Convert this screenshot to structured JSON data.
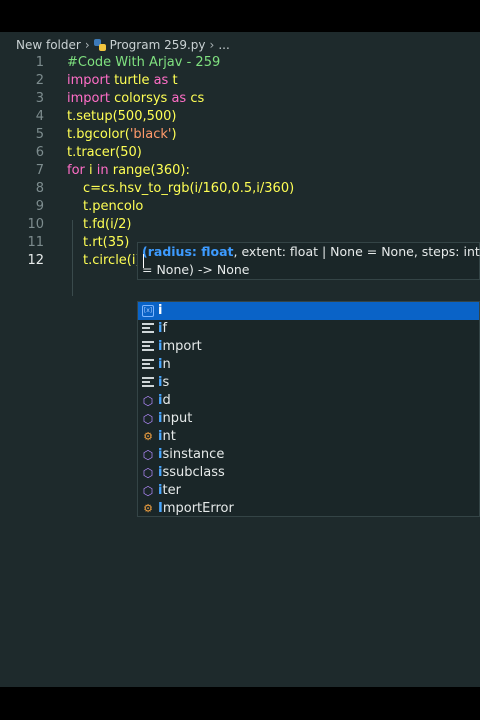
{
  "breadcrumb": {
    "folder": "New folder",
    "file": "Program 259.py",
    "more": "..."
  },
  "code_lines": [
    {
      "n": "1",
      "tokens": [
        {
          "t": "#Code With Arjav - 259",
          "c": "comment"
        }
      ]
    },
    {
      "n": "2",
      "tokens": [
        {
          "t": "import ",
          "c": "kw"
        },
        {
          "t": "turtle ",
          "c": "plain"
        },
        {
          "t": "as ",
          "c": "kw"
        },
        {
          "t": "t",
          "c": "plain"
        }
      ]
    },
    {
      "n": "3",
      "tokens": [
        {
          "t": "import ",
          "c": "kw"
        },
        {
          "t": "colorsys ",
          "c": "plain"
        },
        {
          "t": "as ",
          "c": "kw"
        },
        {
          "t": "cs",
          "c": "plain"
        }
      ]
    },
    {
      "n": "4",
      "tokens": [
        {
          "t": "t.setup(500,500)",
          "c": "plain"
        }
      ]
    },
    {
      "n": "5",
      "tokens": [
        {
          "t": "t.bgcolor(",
          "c": "plain"
        },
        {
          "t": "'black'",
          "c": "str"
        },
        {
          "t": ")",
          "c": "plain"
        }
      ]
    },
    {
      "n": "6",
      "tokens": [
        {
          "t": "t.tracer(50)",
          "c": "plain"
        }
      ]
    },
    {
      "n": "7",
      "tokens": [
        {
          "t": "for ",
          "c": "kw"
        },
        {
          "t": "i ",
          "c": "plain"
        },
        {
          "t": "in ",
          "c": "kw"
        },
        {
          "t": "range(360):",
          "c": "plain"
        }
      ]
    },
    {
      "n": "8",
      "indent": true,
      "tokens": [
        {
          "t": "c=cs.hsv_to_rgb(i/160,0.5,i/360)",
          "c": "plain"
        }
      ]
    },
    {
      "n": "9",
      "indent": true,
      "tokens": [
        {
          "t": "t.pencolo",
          "c": "plain"
        }
      ]
    },
    {
      "n": "10",
      "indent": true,
      "tokens": [
        {
          "t": "t.fd(i/2)",
          "c": "plain"
        }
      ]
    },
    {
      "n": "11",
      "indent": true,
      "tokens": [
        {
          "t": "t.rt(35)",
          "c": "plain"
        }
      ]
    },
    {
      "n": "12",
      "indent": true,
      "active": true,
      "tokens": [
        {
          "t": "t.circle(i)",
          "c": "plain"
        }
      ]
    }
  ],
  "signature_help": {
    "open": "(",
    "param": "radius: float",
    "rest1": ", extent: float | None = None, steps: int",
    "rest2": "= None) -> None"
  },
  "suggestions": [
    {
      "label": "i",
      "kind": "variable",
      "selected": true
    },
    {
      "label": "if",
      "kind": "keyword"
    },
    {
      "label": "import",
      "kind": "keyword"
    },
    {
      "label": "in",
      "kind": "keyword"
    },
    {
      "label": "is",
      "kind": "keyword"
    },
    {
      "label": "id",
      "kind": "function"
    },
    {
      "label": "input",
      "kind": "function"
    },
    {
      "label": "int",
      "kind": "class"
    },
    {
      "label": "isinstance",
      "kind": "function"
    },
    {
      "label": "issubclass",
      "kind": "function"
    },
    {
      "label": "iter",
      "kind": "function"
    },
    {
      "label": "ImportError",
      "kind": "class"
    }
  ],
  "colors": {
    "editor_bg": "#1e2a2c",
    "keyword": "#ff6ec7",
    "identifier": "#ffff55",
    "comment": "#7fe07f",
    "string": "#ff9a6a",
    "selection": "#0a63c7"
  }
}
